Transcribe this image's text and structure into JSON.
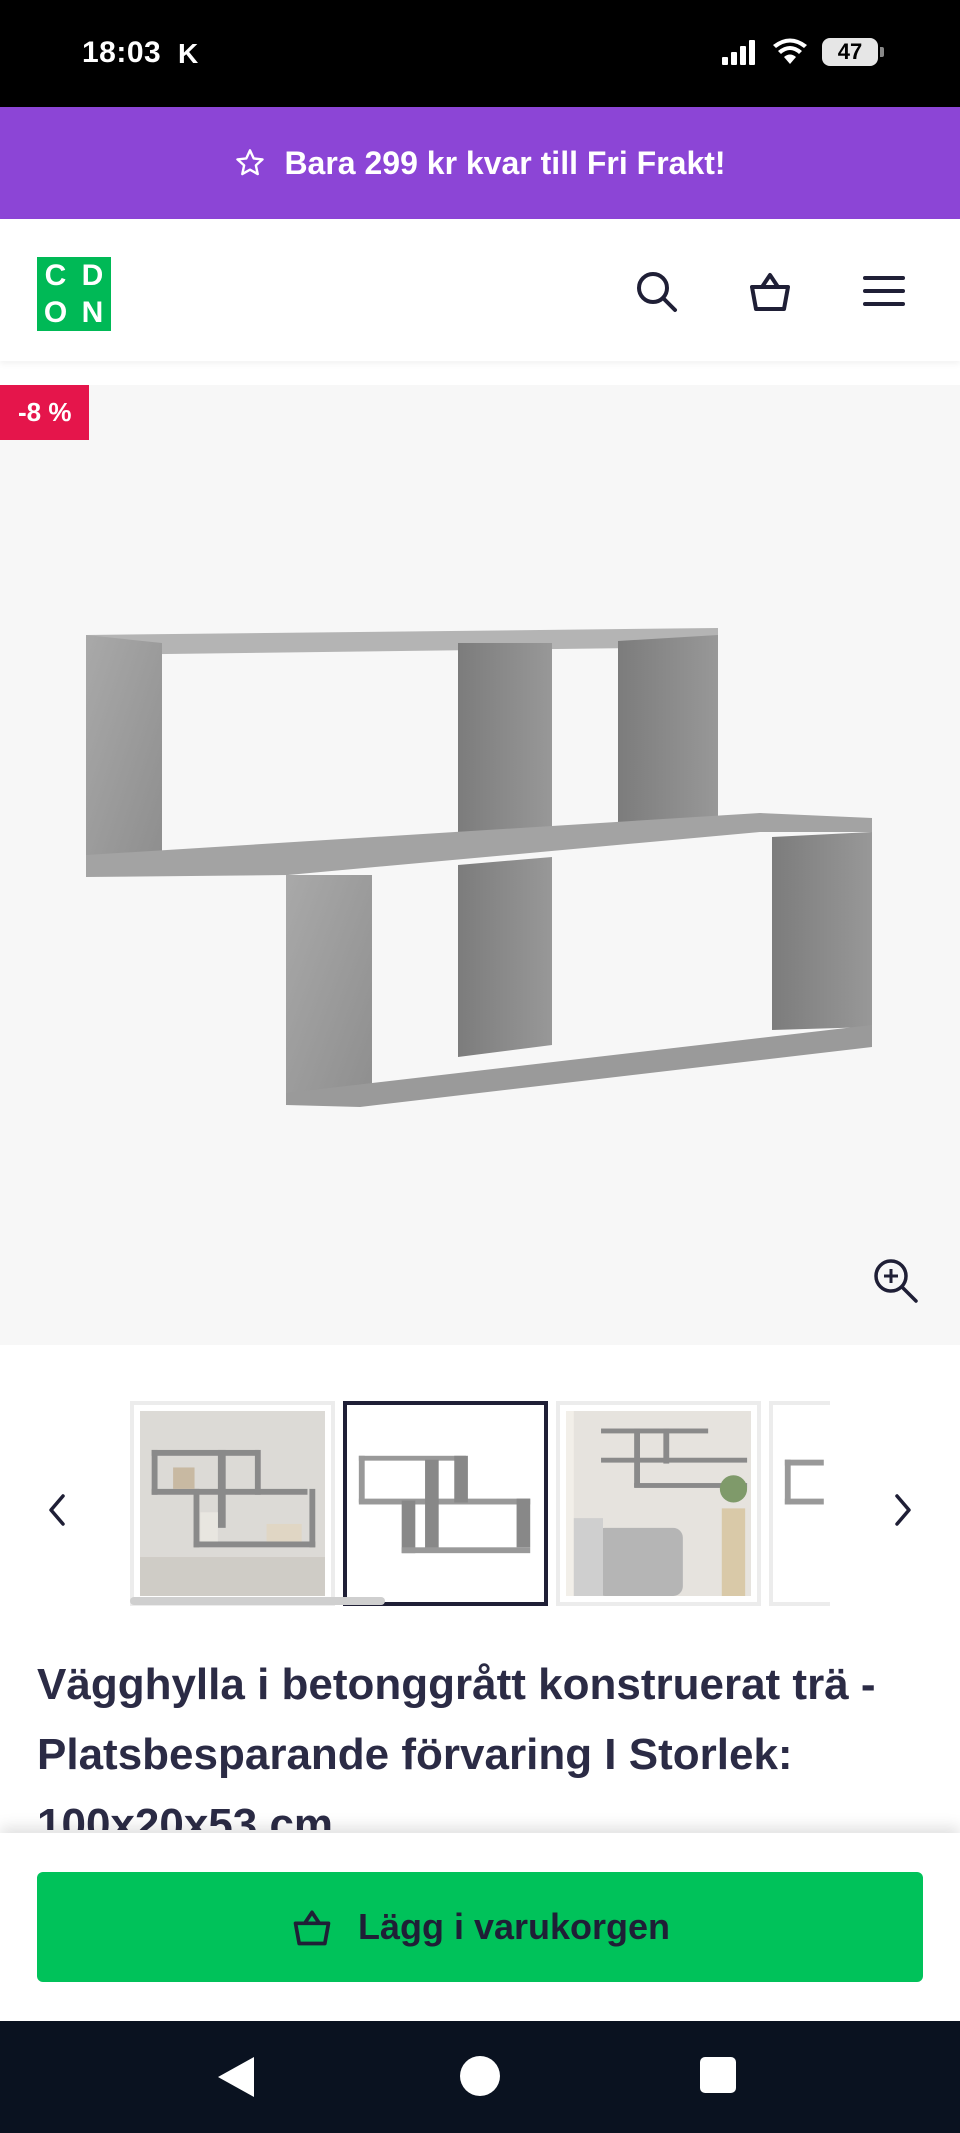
{
  "status_bar": {
    "time": "18:03",
    "carrier_letter": "K",
    "battery": "47"
  },
  "promo": {
    "text": "Bara 299 kr kvar till Fri Frakt!",
    "icon": "star-icon",
    "bg_color": "#8c45d6"
  },
  "header": {
    "logo_letters": [
      "C",
      "D",
      "O",
      "N"
    ],
    "logo_color": "#00b956",
    "icons": [
      "search-icon",
      "basket-icon",
      "menu-icon"
    ]
  },
  "product": {
    "discount_badge": "-8 %",
    "discount_color": "#e5154b",
    "title": "Vägghylla i betonggrått konstruerat trä - Platsbesparande förvaring I Storlek: 100x20x53 cm"
  },
  "thumbnails": {
    "count_visible": 4,
    "active_index": 1
  },
  "cta": {
    "label": "Lägg i varukorgen",
    "color": "#00c25a"
  }
}
